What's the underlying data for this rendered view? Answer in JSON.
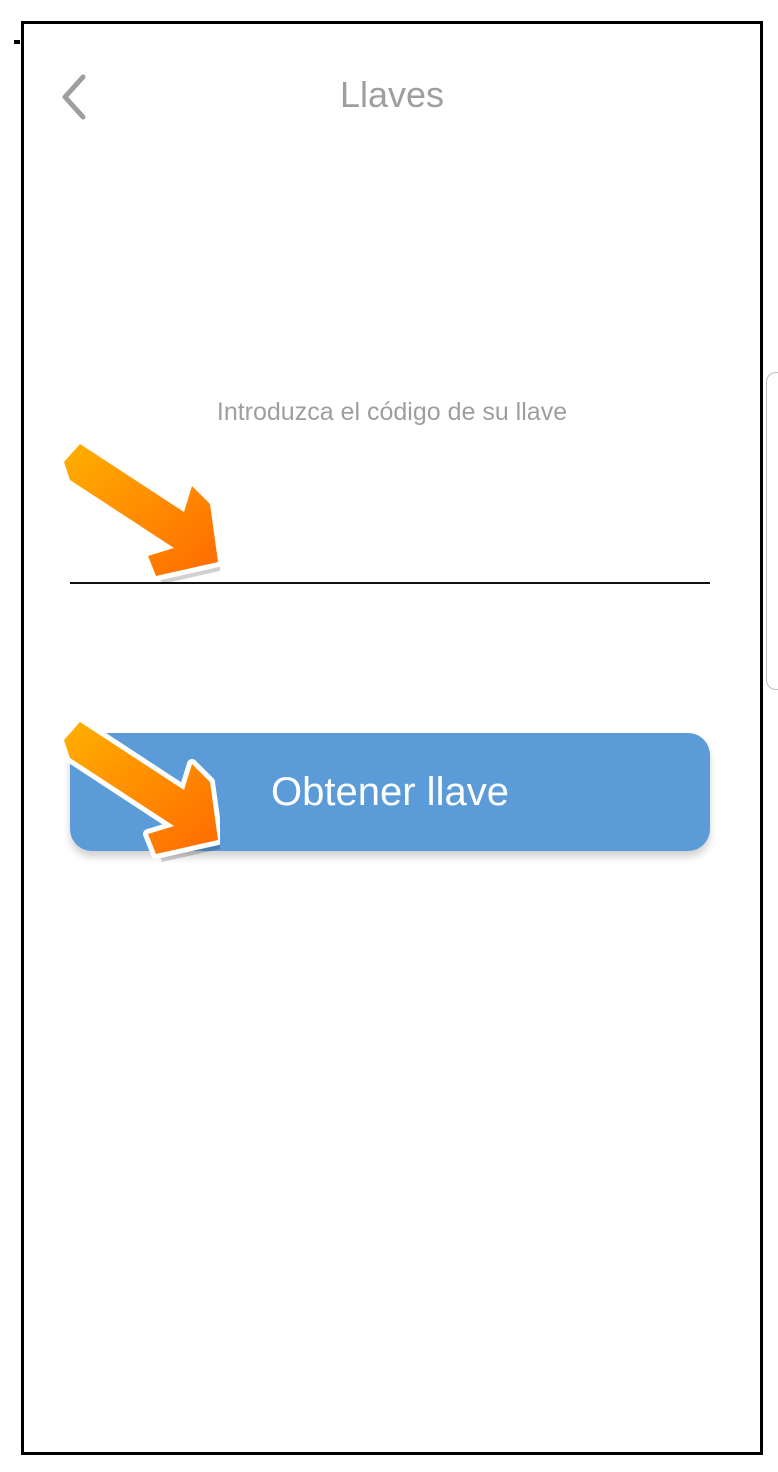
{
  "header": {
    "title": "Llaves",
    "back_icon": "chevron-left-icon"
  },
  "form": {
    "label": "Introduzca el código de su llave",
    "code_value": "",
    "submit_label": "Obtener llave"
  },
  "colors": {
    "button": "#5b9bd8",
    "title_text": "#9e9e9e",
    "arrow_start": "#ffb000",
    "arrow_end": "#ff6a00"
  },
  "annotations": {
    "arrow_icon": "orange-arrow-icon"
  }
}
